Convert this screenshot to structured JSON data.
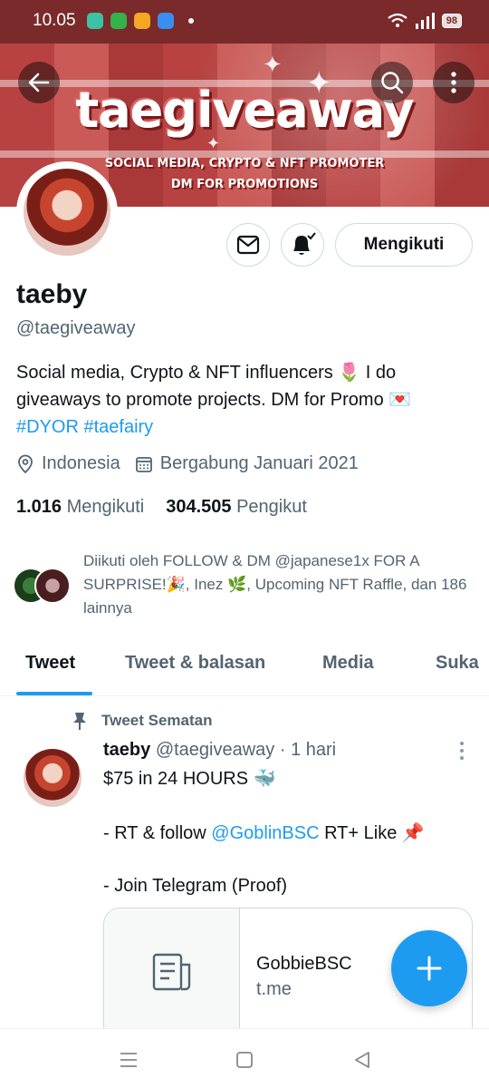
{
  "status_bar": {
    "time": "10.05",
    "battery": "98",
    "colors": {
      "background": "#7a2a2a"
    }
  },
  "banner": {
    "title": "taegiveaway",
    "line1": "SOCIAL MEDIA, CRYPTO & NFT PROMOTER",
    "line2": "DM FOR PROMOTIONS"
  },
  "profile": {
    "follow_button": "Mengikuti",
    "name": "taeby",
    "handle": "@taegiveaway",
    "bio_line1": "Social media, Crypto & NFT influencers 🌷 I do",
    "bio_line2": "giveaways to promote projects. DM for Promo 💌",
    "hashtag1": "#DYOR",
    "hashtag2": "#taefairy",
    "location": "Indonesia",
    "joined": "Bergabung Januari 2021",
    "following_count": "1.016",
    "following_label": "Mengikuti",
    "followers_count": "304.505",
    "followers_label": "Pengikut",
    "followed_by": "Diikuti oleh FOLLOW & DM @japanese1x FOR A SURPRISE!🎉, Inez 🌿, Upcoming NFT Raffle, dan 186 lainnya"
  },
  "tabs": [
    {
      "label": "Tweet",
      "active": true
    },
    {
      "label": "Tweet & balasan",
      "active": false
    },
    {
      "label": "Media",
      "active": false
    },
    {
      "label": "Suka",
      "active": false
    }
  ],
  "pinned_tweet": {
    "pinned_label": "Tweet Sematan",
    "author": "taeby",
    "handle": "@taegiveaway",
    "separator": "·",
    "time": "1 hari",
    "line1": "$75 in 24 HOURS 🐳",
    "line2_prefix": "- RT & follow ",
    "line2_mention": "@GoblinBSC",
    "line2_suffix": " RT+ Like 📌",
    "line3": "- Join Telegram (Proof)",
    "card_title": "GobbieBSC",
    "card_url": "t.me"
  },
  "icons": {
    "back": "back-arrow-icon",
    "search": "search-icon",
    "more": "more-vertical-icon",
    "message": "mail-icon",
    "notify": "bell-icon",
    "location": "location-pin-icon",
    "calendar": "calendar-icon",
    "pin": "pin-icon",
    "compose": "plus-icon"
  },
  "colors": {
    "accent": "#1d9bf0",
    "text": "#0f1419",
    "secondary_text": "#536471"
  }
}
